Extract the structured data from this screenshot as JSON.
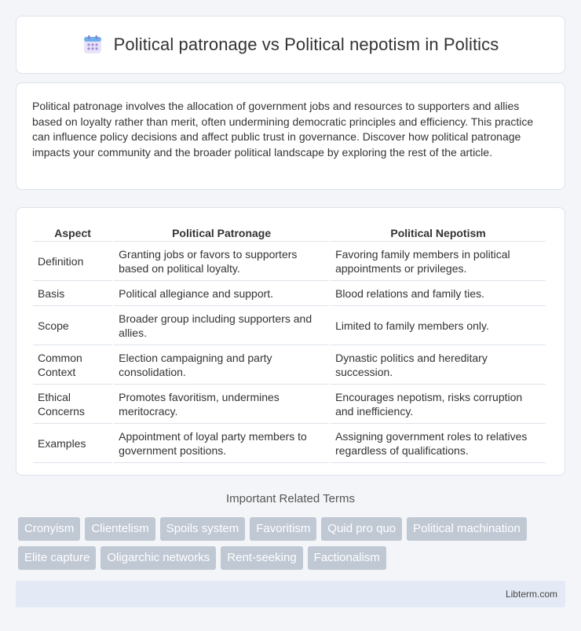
{
  "header": {
    "title": "Political patronage vs Political nepotism in Politics",
    "icon": "calendar-icon"
  },
  "intro": {
    "text": "Political patronage involves the allocation of government jobs and resources to supporters and allies based on loyalty rather than merit, often undermining democratic principles and efficiency. This practice can influence policy decisions and affect public trust in governance. Discover how political patronage impacts your community and the broader political landscape by exploring the rest of the article."
  },
  "table": {
    "headers": [
      "Aspect",
      "Political Patronage",
      "Political Nepotism"
    ],
    "rows": [
      [
        "Definition",
        "Granting jobs or favors to supporters based on political loyalty.",
        "Favoring family members in political appointments or privileges."
      ],
      [
        "Basis",
        "Political allegiance and support.",
        "Blood relations and family ties."
      ],
      [
        "Scope",
        "Broader group including supporters and allies.",
        "Limited to family members only."
      ],
      [
        "Common Context",
        "Election campaigning and party consolidation.",
        "Dynastic politics and hereditary succession."
      ],
      [
        "Ethical Concerns",
        "Promotes favoritism, undermines meritocracy.",
        "Encourages nepotism, risks corruption and inefficiency."
      ],
      [
        "Examples",
        "Appointment of loyal party members to government positions.",
        "Assigning government roles to relatives regardless of qualifications."
      ]
    ]
  },
  "related": {
    "title": "Important Related Terms",
    "terms": [
      "Cronyism",
      "Clientelism",
      "Spoils system",
      "Favoritism",
      "Quid pro quo",
      "Political machination",
      "Elite capture",
      "Oligarchic networks",
      "Rent-seeking",
      "Factionalism"
    ]
  },
  "footer": {
    "site": "Libterm.com"
  },
  "colors": {
    "background": "#f3f5f8",
    "tag_background": "#c0c8d4",
    "footer_background": "#e4eaf5"
  }
}
